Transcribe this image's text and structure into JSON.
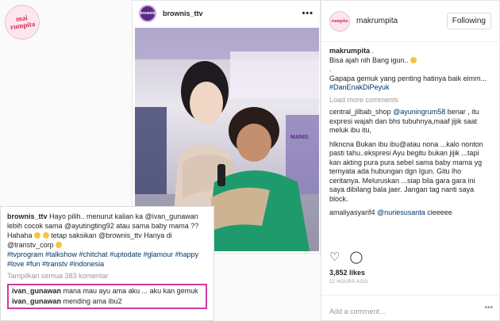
{
  "corner_logo": "mai rumpita",
  "post": {
    "username": "brownis_ttv",
    "avatar_text": "brownis",
    "more": "•••"
  },
  "caption": {
    "username": "brownis_ttv",
    "text": "Hayo pilih.. menurut kalian ka @ivan_gunawan lebih cocok sama @ayutingting92 atau sama baby mama ?? Hahaha",
    "text2": "tetap saksikan @brownis_ttv Hanya di @transtv_corp",
    "hashtags": "#tvprogram #talkshow #chitchat #uptodate #glamour #happy #love #fun #transtv #indonesia",
    "view_all": "Tampilkan semua 383 komentar",
    "highlighted": [
      {
        "username": "ivan_gunawan",
        "text": "mana mau ayu ama aku ... aku kan gemuk"
      },
      {
        "username": "ivan_gunawan",
        "text": "mending ama ibu2"
      }
    ]
  },
  "panel": {
    "username": "makrumpita",
    "avatar_text": "rumpita",
    "follow_label": "Following",
    "comments": [
      {
        "username": "makrumpita",
        "text": "."
      },
      {
        "text": "Bisa ajah nih Bang igun.."
      },
      {
        "text": "."
      },
      {
        "text": "Gapapa gemuk yang penting hatinya baik eimm..."
      },
      {
        "tag": "#DanEnakDiPeyuk"
      }
    ],
    "load_more": "Load more comments",
    "threads": [
      {
        "username": "central_jilbab_shop",
        "mention": "@ayuningrum58",
        "text": "benar , itu expresi wajah dan bhs tubuhnya,maaf jijik saat meluk ibu itu,"
      },
      {
        "username": "",
        "text": "hlkncna Bukan ibu ibu@atau nona ...kalo nonton pasti tahu..ekspresi Ayu begitu bukan jijik ...tapi kan akting pura pura sebel sama baby mama yg ternyata ada hubungan dgn Igun. Gitu lho ceritanya. Meluruskan ...siap bila gara gara ini saya dibilang bala jaer. Jangan tag nanti saya block."
      },
      {
        "username": "amaliyasyarif4",
        "mention": "@nuriesusanta",
        "text": "cieeeee"
      }
    ],
    "likes": "3,852 likes",
    "timestamp": "22 HOURS AGO",
    "add_comment_placeholder": "Add a comment...",
    "more_dots": "•••"
  },
  "colors": {
    "accent": "#cf3ba0",
    "tag": "#003569",
    "muted": "#999999"
  }
}
